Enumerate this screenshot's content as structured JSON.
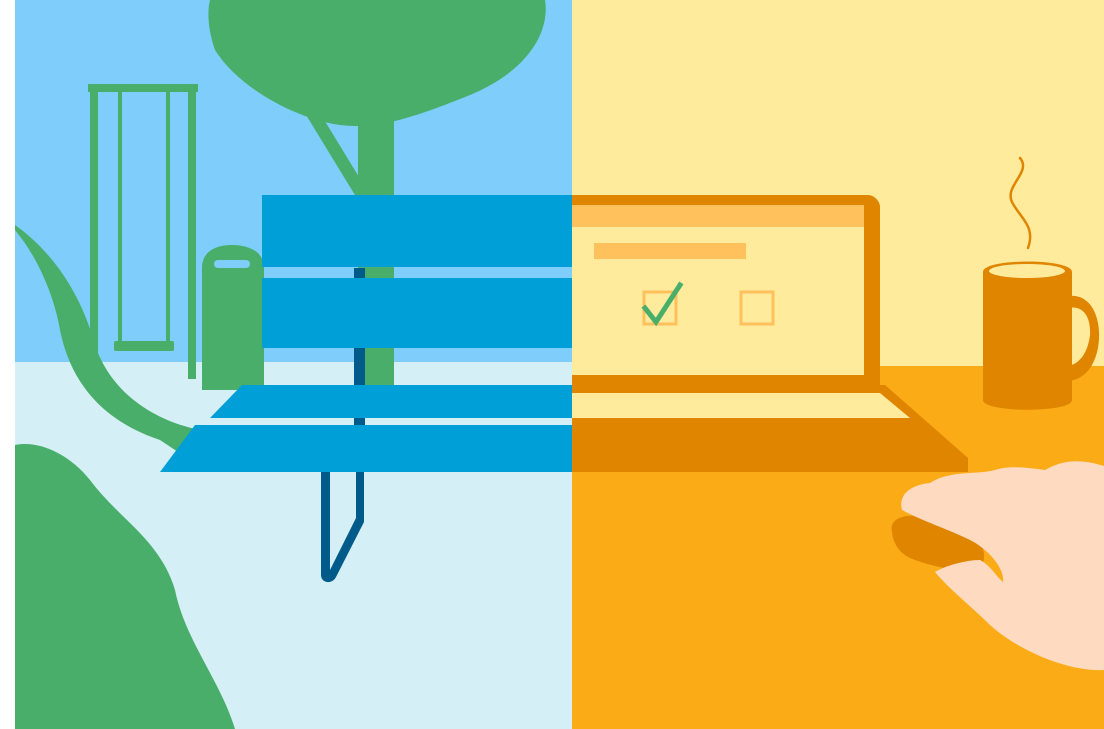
{
  "illustration": {
    "left_panel": {
      "subject": "park",
      "colors": {
        "sky": "#7ecdfb",
        "ground": "#d5eff6",
        "foliage": "#48ae6a",
        "bench": "#009fd8",
        "bench_leg": "#005b8a"
      },
      "icons": [
        "swing-icon",
        "tree-icon",
        "trash-bin-icon",
        "bush-icon",
        "park-bench-icon"
      ]
    },
    "right_panel": {
      "subject": "desk",
      "colors": {
        "wall": "#ffeb9b",
        "desk": "#fbab16",
        "device": "#e08500",
        "screen_bar": "#ffc15c",
        "checkmark": "#48ae6a",
        "hand": "#fddac0"
      },
      "icons": [
        "laptop-icon",
        "checkbox-checked-icon",
        "checkbox-empty-icon",
        "coffee-mug-icon",
        "steam-icon",
        "hand-icon",
        "mouse-icon"
      ]
    }
  }
}
